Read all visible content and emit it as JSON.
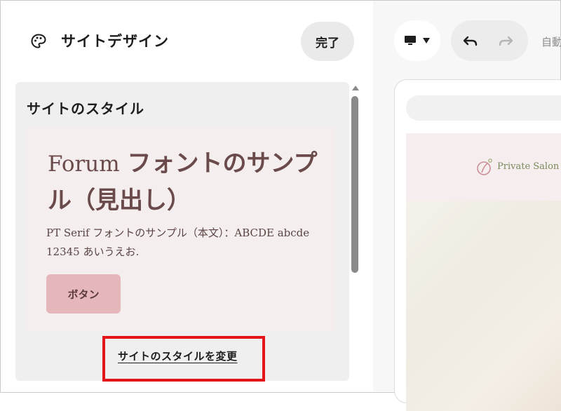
{
  "header": {
    "title": "サイトデザイン",
    "done_label": "完了"
  },
  "styles": {
    "card_title": "サイトのスタイル",
    "heading_latin": "Forum",
    "heading_jp": "フォントのサンプル（見出し）",
    "body_text": "PT Serif フォントのサンプル（本文）：ABCDE abcde 12345 あいうえお.",
    "button_label": "ボタン",
    "change_link": "サイトのスタイルを変更"
  },
  "toolbar": {
    "autosave_label": "自動"
  },
  "preview": {
    "site_name": "Private Salon"
  },
  "colors": {
    "accent_button": "#e5b7bb",
    "heading_color": "#6a4a4a",
    "highlight_box": "#e3151a"
  }
}
